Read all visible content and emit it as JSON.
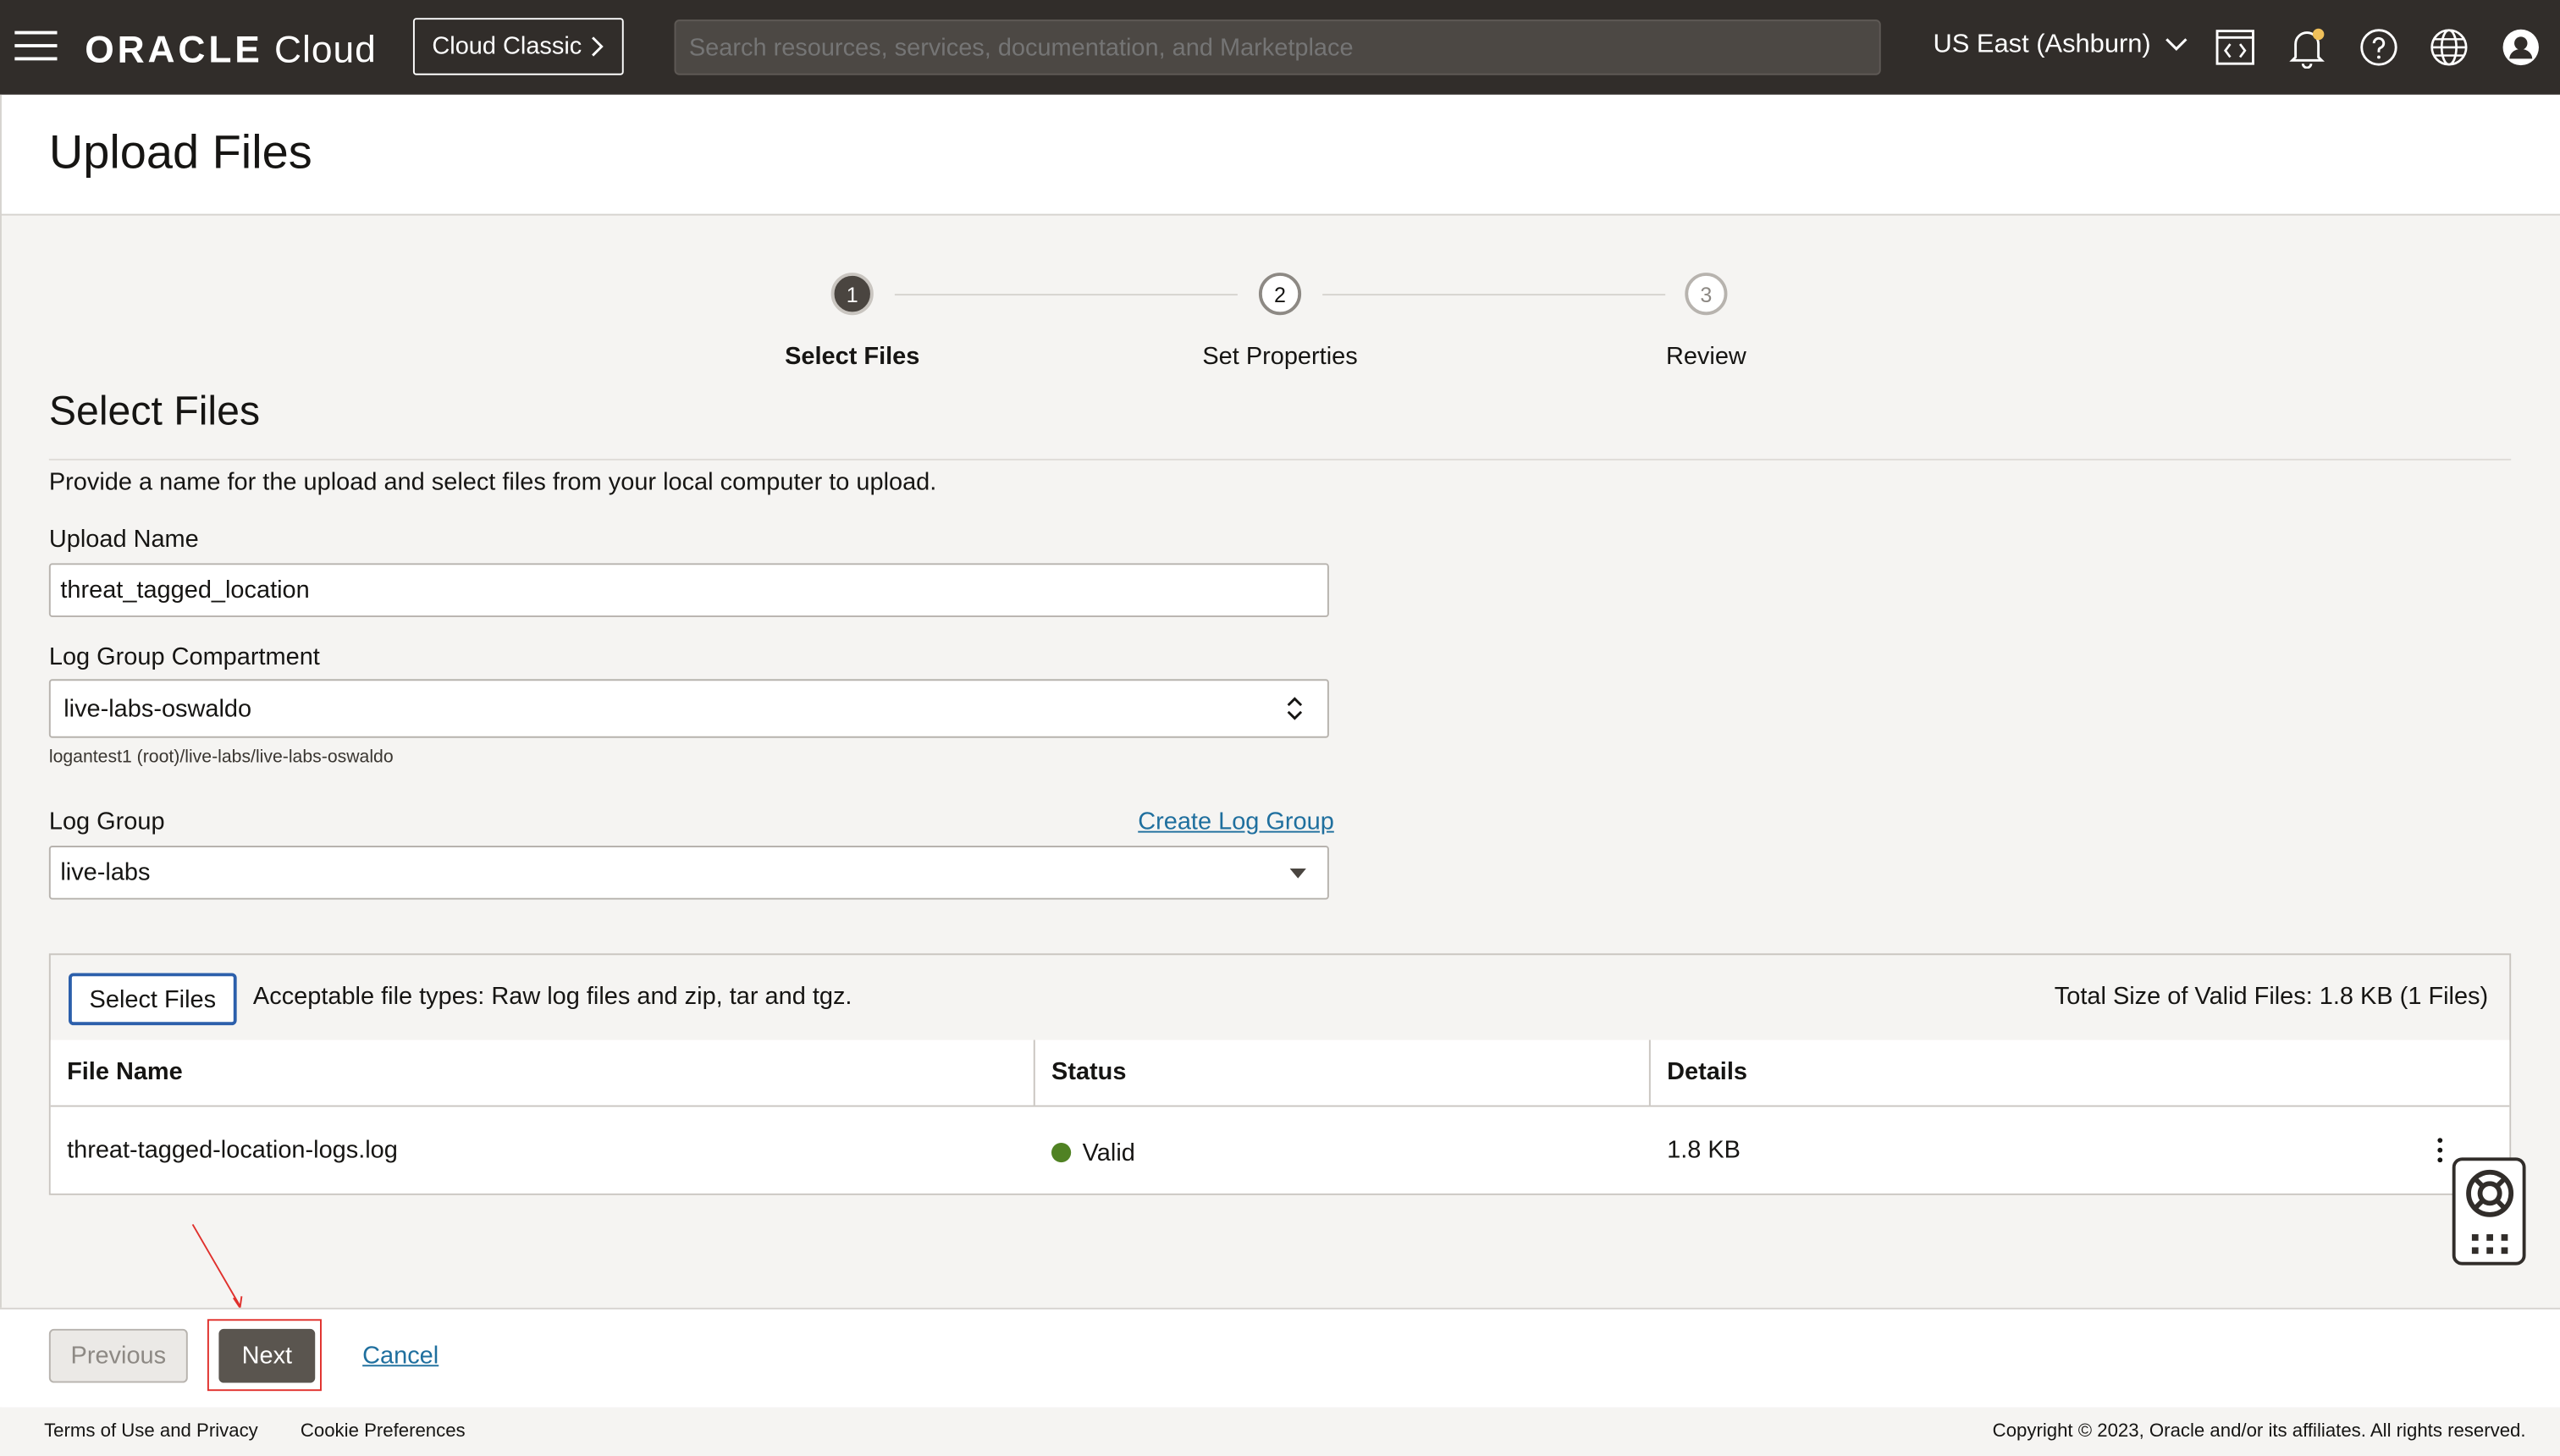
{
  "header": {
    "logo_oracle": "ORACLE",
    "logo_cloud": "Cloud",
    "cloud_classic": "Cloud Classic",
    "search_placeholder": "Search resources, services, documentation, and Marketplace",
    "region": "US East (Ashburn)"
  },
  "page": {
    "title": "Upload Files"
  },
  "wizard": {
    "steps": [
      {
        "number": "1",
        "label": "Select Files",
        "state": "active"
      },
      {
        "number": "2",
        "label": "Set Properties",
        "state": "pending"
      },
      {
        "number": "3",
        "label": "Review",
        "state": "pending"
      }
    ]
  },
  "section": {
    "title": "Select Files",
    "description": "Provide a name for the upload and select files from your local computer to upload."
  },
  "form": {
    "upload_name_label": "Upload Name",
    "upload_name_value": "threat_tagged_location",
    "compartment_label": "Log Group Compartment",
    "compartment_value": "live-labs-oswaldo",
    "compartment_path": "logantest1 (root)/live-labs/live-labs-oswaldo",
    "log_group_label": "Log Group",
    "create_log_group": "Create Log Group",
    "log_group_value": "live-labs"
  },
  "files": {
    "select_button": "Select Files",
    "acceptable_types": "Acceptable file types: Raw log files and zip, tar and tgz.",
    "total_size": "Total Size of Valid Files: 1.8 KB (1 Files)",
    "columns": [
      "File Name",
      "Status",
      "Details"
    ],
    "rows": [
      {
        "file_name": "threat-tagged-location-logs.log",
        "status": "Valid",
        "details": "1.8 KB"
      }
    ],
    "status_color": "#508223"
  },
  "actions": {
    "previous": "Previous",
    "next": "Next",
    "cancel": "Cancel"
  },
  "footer": {
    "terms": "Terms of Use and Privacy",
    "cookies": "Cookie Preferences",
    "copyright": "Copyright © 2023, Oracle and/or its affiliates. All rights reserved."
  },
  "colors": {
    "topbar": "#312d2a",
    "primary_button": "#5a554f",
    "link": "#1f6f9e",
    "annotation": "#e0302c"
  },
  "icons": [
    "hamburger-menu-icon",
    "chevron-right-icon",
    "chevron-down-icon",
    "code-editor-icon",
    "bell-icon",
    "help-icon",
    "globe-icon",
    "user-profile-icon",
    "sort-updown-icon",
    "caret-down-icon",
    "kebab-menu-icon",
    "lifebuoy-icon",
    "apps-grid-icon"
  ]
}
